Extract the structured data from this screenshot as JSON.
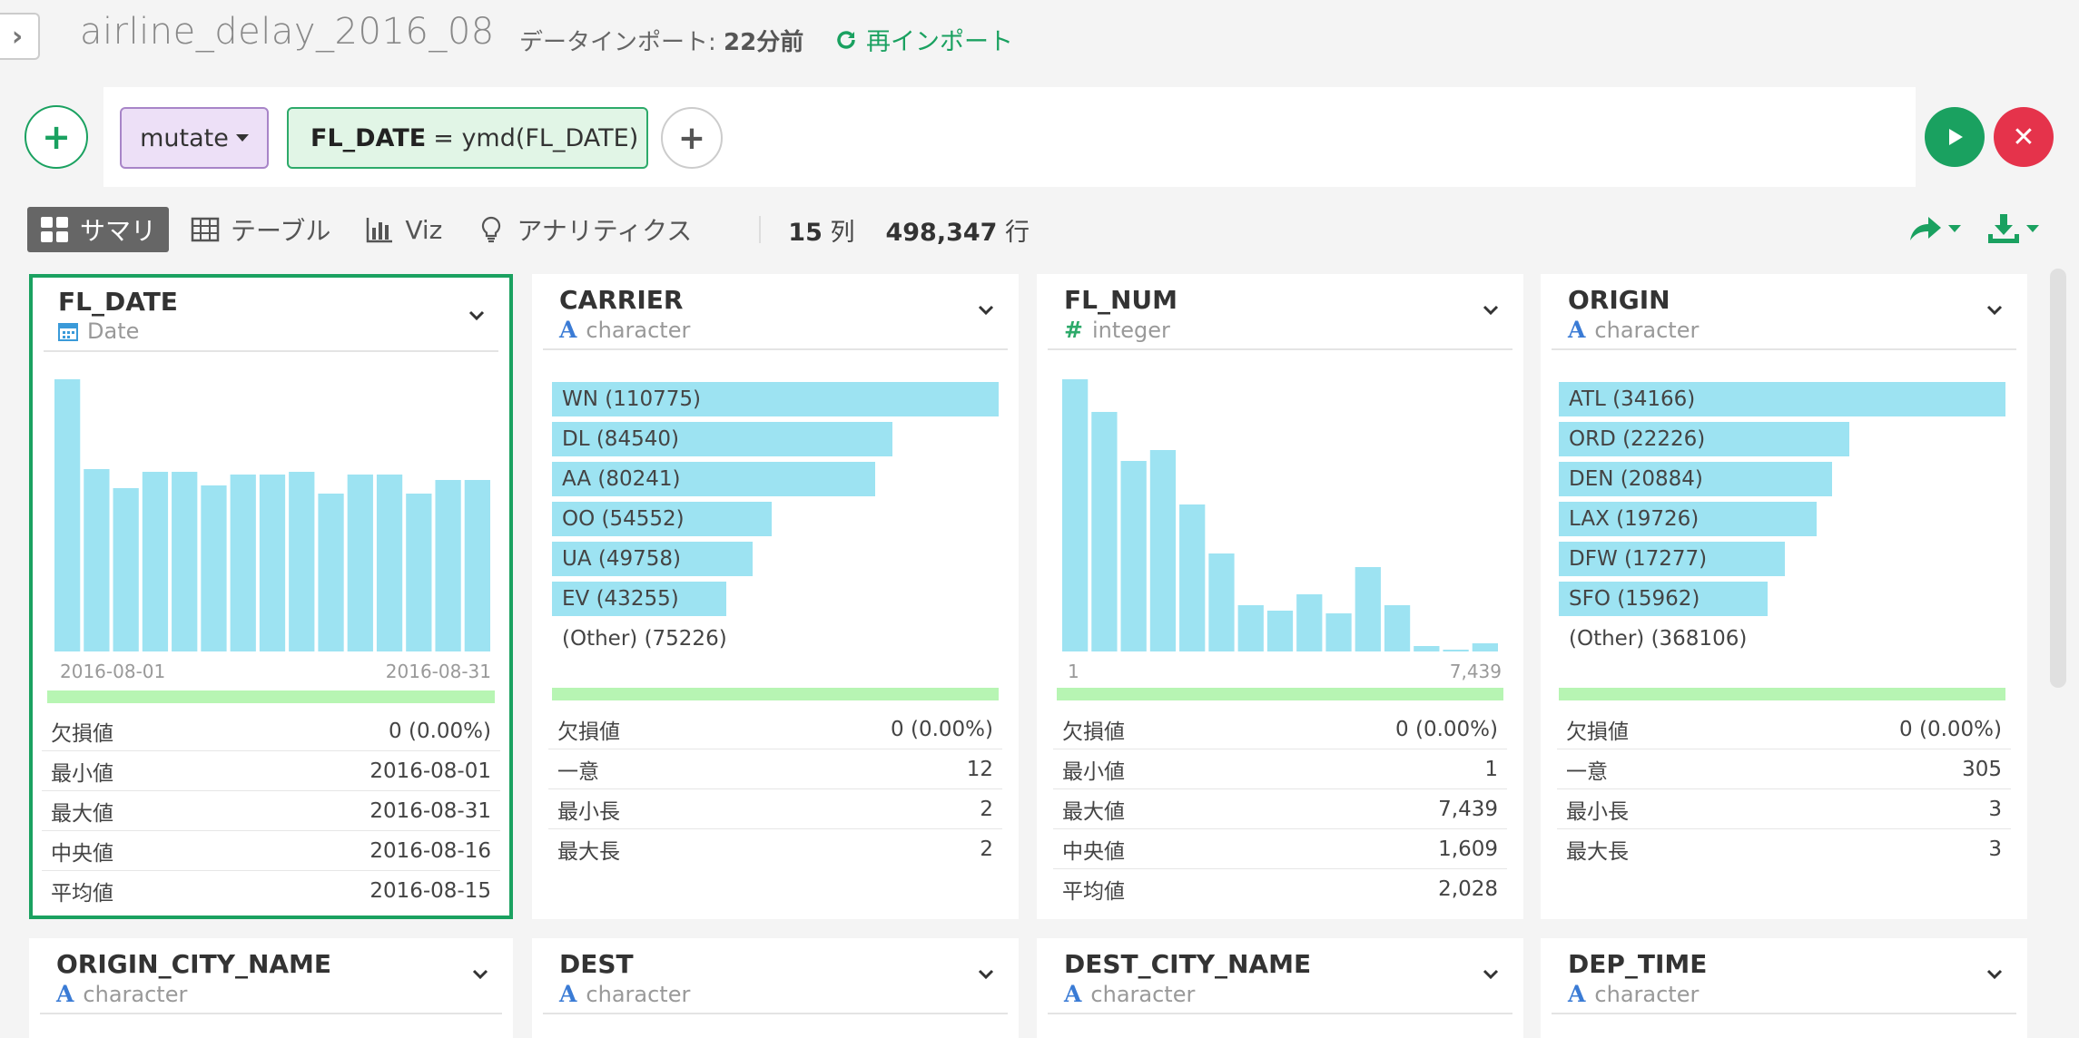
{
  "header": {
    "title": "airline_delay_2016_08",
    "import_label": "データインポート:",
    "import_ago": "22分前",
    "reimport_label": "再インポート"
  },
  "command": {
    "verb": "mutate",
    "expr_column": "FL_DATE",
    "expr_rest": "= ymd(FL_DATE)"
  },
  "tabs": [
    {
      "label": "サマリ",
      "icon": "grid-icon",
      "active": true
    },
    {
      "label": "テーブル",
      "icon": "table-icon"
    },
    {
      "label": "Viz",
      "icon": "bar-chart-icon"
    },
    {
      "label": "アナリティクス",
      "icon": "lightbulb-icon"
    }
  ],
  "counts": {
    "cols_value": "15",
    "cols_unit": "列",
    "rows_value": "498,347",
    "rows_unit": "行"
  },
  "colors": {
    "accent": "#1aa160",
    "danger": "#e5334b",
    "bar": "#9de3f2",
    "completeness": "#b7f5b3"
  },
  "cards": [
    {
      "name": "FL_DATE",
      "type": "Date",
      "type_icon": "calendar-icon",
      "selected": true,
      "histogram": [
        1.0,
        0.67,
        0.6,
        0.66,
        0.66,
        0.61,
        0.65,
        0.65,
        0.66,
        0.58,
        0.65,
        0.65,
        0.58,
        0.63,
        0.63
      ],
      "axis_min": "2016-08-01",
      "axis_max": "2016-08-31",
      "stats": [
        {
          "label": "欠損値",
          "value": "0 (0.00%)"
        },
        {
          "label": "最小値",
          "value": "2016-08-01"
        },
        {
          "label": "最大値",
          "value": "2016-08-31"
        },
        {
          "label": "中央値",
          "value": "2016-08-16"
        },
        {
          "label": "平均値",
          "value": "2016-08-15"
        }
      ]
    },
    {
      "name": "CARRIER",
      "type": "character",
      "type_icon": "text-a-icon",
      "categories": [
        {
          "label": "WN (110775)",
          "count": 110775
        },
        {
          "label": "DL (84540)",
          "count": 84540
        },
        {
          "label": "AA (80241)",
          "count": 80241
        },
        {
          "label": "OO (54552)",
          "count": 54552
        },
        {
          "label": "UA (49758)",
          "count": 49758
        },
        {
          "label": "EV (43255)",
          "count": 43255
        },
        {
          "label": "(Other) (75226)",
          "count": 0
        }
      ],
      "stats": [
        {
          "label": "欠損値",
          "value": "0 (0.00%)"
        },
        {
          "label": "一意",
          "value": "12"
        },
        {
          "label": "最小長",
          "value": "2"
        },
        {
          "label": "最大長",
          "value": "2"
        }
      ]
    },
    {
      "name": "FL_NUM",
      "type": "integer",
      "type_icon": "hash-icon",
      "histogram": [
        1.0,
        0.88,
        0.7,
        0.74,
        0.54,
        0.36,
        0.17,
        0.15,
        0.21,
        0.14,
        0.31,
        0.17,
        0.02,
        0.0,
        0.03
      ],
      "axis_min": "1",
      "axis_max": "7,439",
      "stats": [
        {
          "label": "欠損値",
          "value": "0 (0.00%)"
        },
        {
          "label": "最小値",
          "value": "1"
        },
        {
          "label": "最大値",
          "value": "7,439"
        },
        {
          "label": "中央値",
          "value": "1,609"
        },
        {
          "label": "平均値",
          "value": "2,028"
        }
      ]
    },
    {
      "name": "ORIGIN",
      "type": "character",
      "type_icon": "text-a-icon",
      "categories": [
        {
          "label": "ATL (34166)",
          "count": 34166
        },
        {
          "label": "ORD (22226)",
          "count": 22226
        },
        {
          "label": "DEN (20884)",
          "count": 20884
        },
        {
          "label": "LAX (19726)",
          "count": 19726
        },
        {
          "label": "DFW (17277)",
          "count": 17277
        },
        {
          "label": "SFO (15962)",
          "count": 15962
        },
        {
          "label": "(Other) (368106)",
          "count": 0
        }
      ],
      "stats": [
        {
          "label": "欠損値",
          "value": "0 (0.00%)"
        },
        {
          "label": "一意",
          "value": "305"
        },
        {
          "label": "最小長",
          "value": "3"
        },
        {
          "label": "最大長",
          "value": "3"
        }
      ]
    },
    {
      "name": "ORIGIN_CITY_NAME",
      "type": "character",
      "type_icon": "text-a-icon"
    },
    {
      "name": "DEST",
      "type": "character",
      "type_icon": "text-a-icon"
    },
    {
      "name": "DEST_CITY_NAME",
      "type": "character",
      "type_icon": "text-a-icon"
    },
    {
      "name": "DEP_TIME",
      "type": "character",
      "type_icon": "text-a-icon"
    }
  ]
}
